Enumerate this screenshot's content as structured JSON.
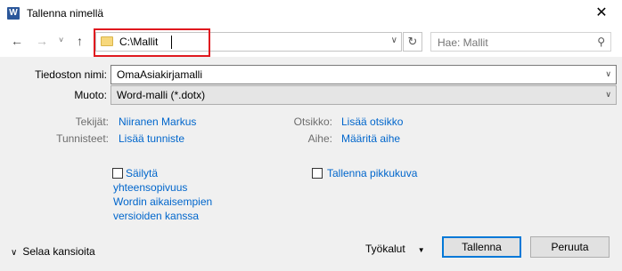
{
  "window": {
    "title": "Tallenna nimellä",
    "app_icon_glyph": "W",
    "close_glyph": "✕"
  },
  "nav": {
    "back_glyph": "←",
    "forward_glyph": "→",
    "recent_glyph": "˅",
    "up_glyph": "↑",
    "address": "C:\\Mallit",
    "address_dropdown_glyph": "∨",
    "refresh_glyph": "↻",
    "search_placeholder": "Hae: Mallit",
    "search_icon_glyph": "⚲"
  },
  "form": {
    "filename_label": "Tiedoston nimi:",
    "filename_value": "OmaAsiakirjamalli",
    "format_label": "Muoto:",
    "format_value": "Word-malli (*.dotx)",
    "combo_arrow_glyph": "∨"
  },
  "metadata": {
    "author_label": "Tekijät:",
    "author_value": "Niiranen Markus",
    "tags_label": "Tunnisteet:",
    "tags_value": "Lisää tunniste",
    "title_label": "Otsikko:",
    "title_value": "Lisää otsikko",
    "subject_label": "Aihe:",
    "subject_value": "Määritä aihe"
  },
  "options": {
    "compat_line1": "Säilytä",
    "compat_line2": "yhteensopivuus",
    "compat_line3": "Wordin aikaisempien",
    "compat_line4": "versioiden kanssa",
    "compat_checked": false,
    "thumbnail_label": "Tallenna pikkukuva",
    "thumbnail_checked": false
  },
  "footer": {
    "browse_label": "Selaa kansioita",
    "browse_chevron": "∨",
    "tools_label": "Työkalut",
    "tools_glyph": "▼",
    "save_label": "Tallenna",
    "cancel_label": "Peruuta"
  },
  "colors": {
    "accent": "#0078d7",
    "link": "#0066cc",
    "highlight": "#e0191f"
  }
}
